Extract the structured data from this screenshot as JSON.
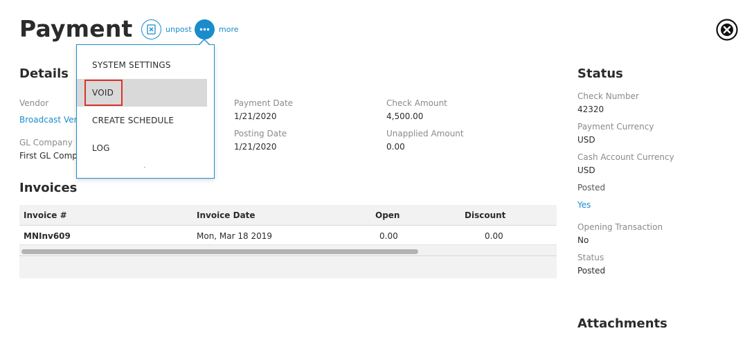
{
  "page": {
    "title": "Payment"
  },
  "actions": {
    "unpost_label": "unpost",
    "more_label": "more"
  },
  "menu": {
    "items": [
      {
        "label": "SYSTEM SETTINGS"
      },
      {
        "label": "VOID"
      },
      {
        "label": "CREATE SCHEDULE"
      },
      {
        "label": "LOG"
      }
    ]
  },
  "details": {
    "title": "Details",
    "vendor_label": "Vendor",
    "vendor_value": "Broadcast Vendor",
    "gl_company_label": "GL Company",
    "gl_company_value": "First GL Company",
    "payment_date_label": "Payment Date",
    "payment_date_value": "1/21/2020",
    "posting_date_label": "Posting Date",
    "posting_date_value": "1/21/2020",
    "check_amount_label": "Check Amount",
    "check_amount_value": "4,500.00",
    "unapplied_amount_label": "Unapplied Amount",
    "unapplied_amount_value": "0.00"
  },
  "invoices": {
    "title": "Invoices",
    "columns": [
      "Invoice #",
      "Invoice Date",
      "Open",
      "Discount"
    ],
    "rows": [
      {
        "invoice": "MNInv609",
        "date": "Mon, Mar 18 2019",
        "open": "0.00",
        "discount": "0.00"
      }
    ]
  },
  "status": {
    "title": "Status",
    "check_number_label": "Check Number",
    "check_number_value": "42320",
    "payment_currency_label": "Payment Currency",
    "payment_currency_value": "USD",
    "cash_account_currency_label": "Cash Account Currency",
    "cash_account_currency_value": "USD",
    "posted_label": "Posted",
    "posted_value": "Yes",
    "opening_transaction_label": "Opening Transaction",
    "opening_transaction_value": "No",
    "status_label": "Status",
    "status_value": "Posted"
  },
  "attachments": {
    "title": "Attachments"
  },
  "colors": {
    "accent": "#1a8ccc",
    "highlight_border": "#d8322b",
    "menu_highlight": "#d9d9d9"
  },
  "icons": {
    "unpost": "unpost-doc-icon",
    "more": "more-dots-icon",
    "close": "close-circle-icon"
  }
}
